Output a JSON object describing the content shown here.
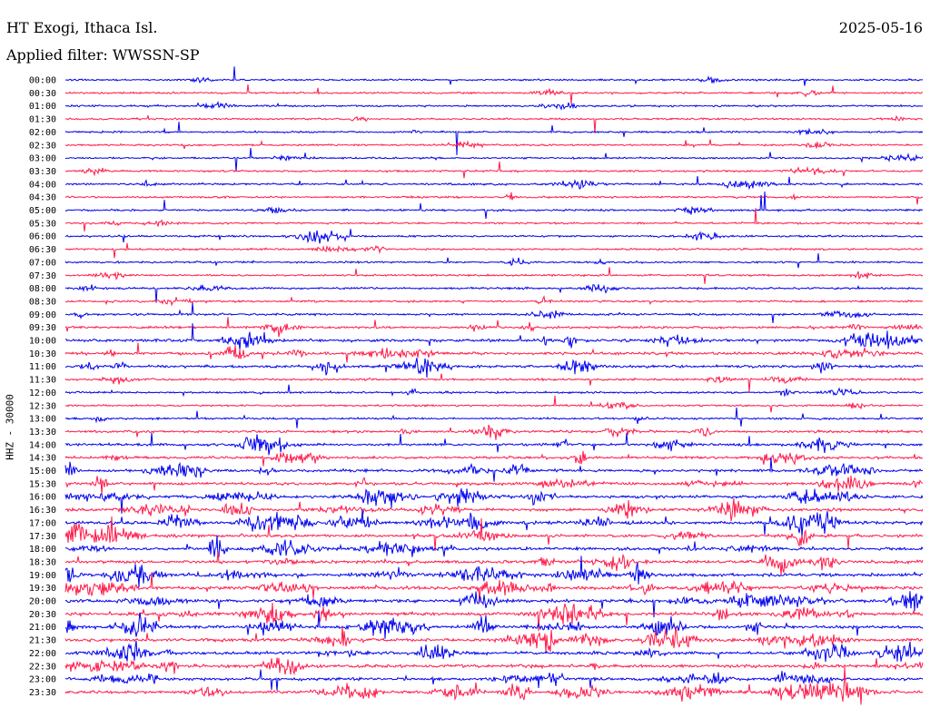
{
  "header": {
    "station": "HT Exogi, Ithaca Isl.",
    "filter": "Applied filter: WWSSN-SP",
    "date": "2025-05-16"
  },
  "chart_data": {
    "type": "line",
    "title": "HT Exogi, Ithaca Isl.",
    "subtitle": "Applied filter: WWSSN-SP",
    "date": "2025-05-16",
    "ylabel": "HHZ - 30000",
    "xlabel": "",
    "grid": false,
    "legend": "none",
    "trace_colors": [
      "#0000ee",
      "#ff1a4a"
    ],
    "y_ticks": [
      "00:00",
      "00:30",
      "01:00",
      "01:30",
      "02:00",
      "02:30",
      "03:00",
      "03:30",
      "04:00",
      "04:30",
      "05:00",
      "05:30",
      "06:00",
      "06:30",
      "07:00",
      "07:30",
      "08:00",
      "08:30",
      "09:00",
      "09:30",
      "10:00",
      "10:30",
      "11:00",
      "11:30",
      "12:00",
      "12:30",
      "13:00",
      "13:30",
      "14:00",
      "14:30",
      "15:00",
      "15:30",
      "16:00",
      "16:30",
      "17:00",
      "17:30",
      "18:00",
      "18:30",
      "19:00",
      "19:30",
      "20:00",
      "20:30",
      "21:00",
      "21:30",
      "22:00",
      "22:30",
      "23:00",
      "23:30"
    ],
    "row_activity": [
      0.08,
      0.08,
      0.08,
      0.1,
      0.1,
      0.08,
      0.1,
      0.14,
      0.18,
      0.12,
      0.12,
      0.1,
      0.16,
      0.14,
      0.1,
      0.1,
      0.16,
      0.12,
      0.18,
      0.3,
      0.45,
      0.45,
      0.4,
      0.2,
      0.18,
      0.12,
      0.14,
      0.3,
      0.35,
      0.4,
      0.45,
      0.45,
      0.5,
      0.5,
      0.55,
      0.55,
      0.55,
      0.55,
      0.6,
      0.6,
      0.6,
      0.6,
      0.6,
      0.6,
      0.6,
      0.55,
      0.55,
      0.55
    ]
  }
}
